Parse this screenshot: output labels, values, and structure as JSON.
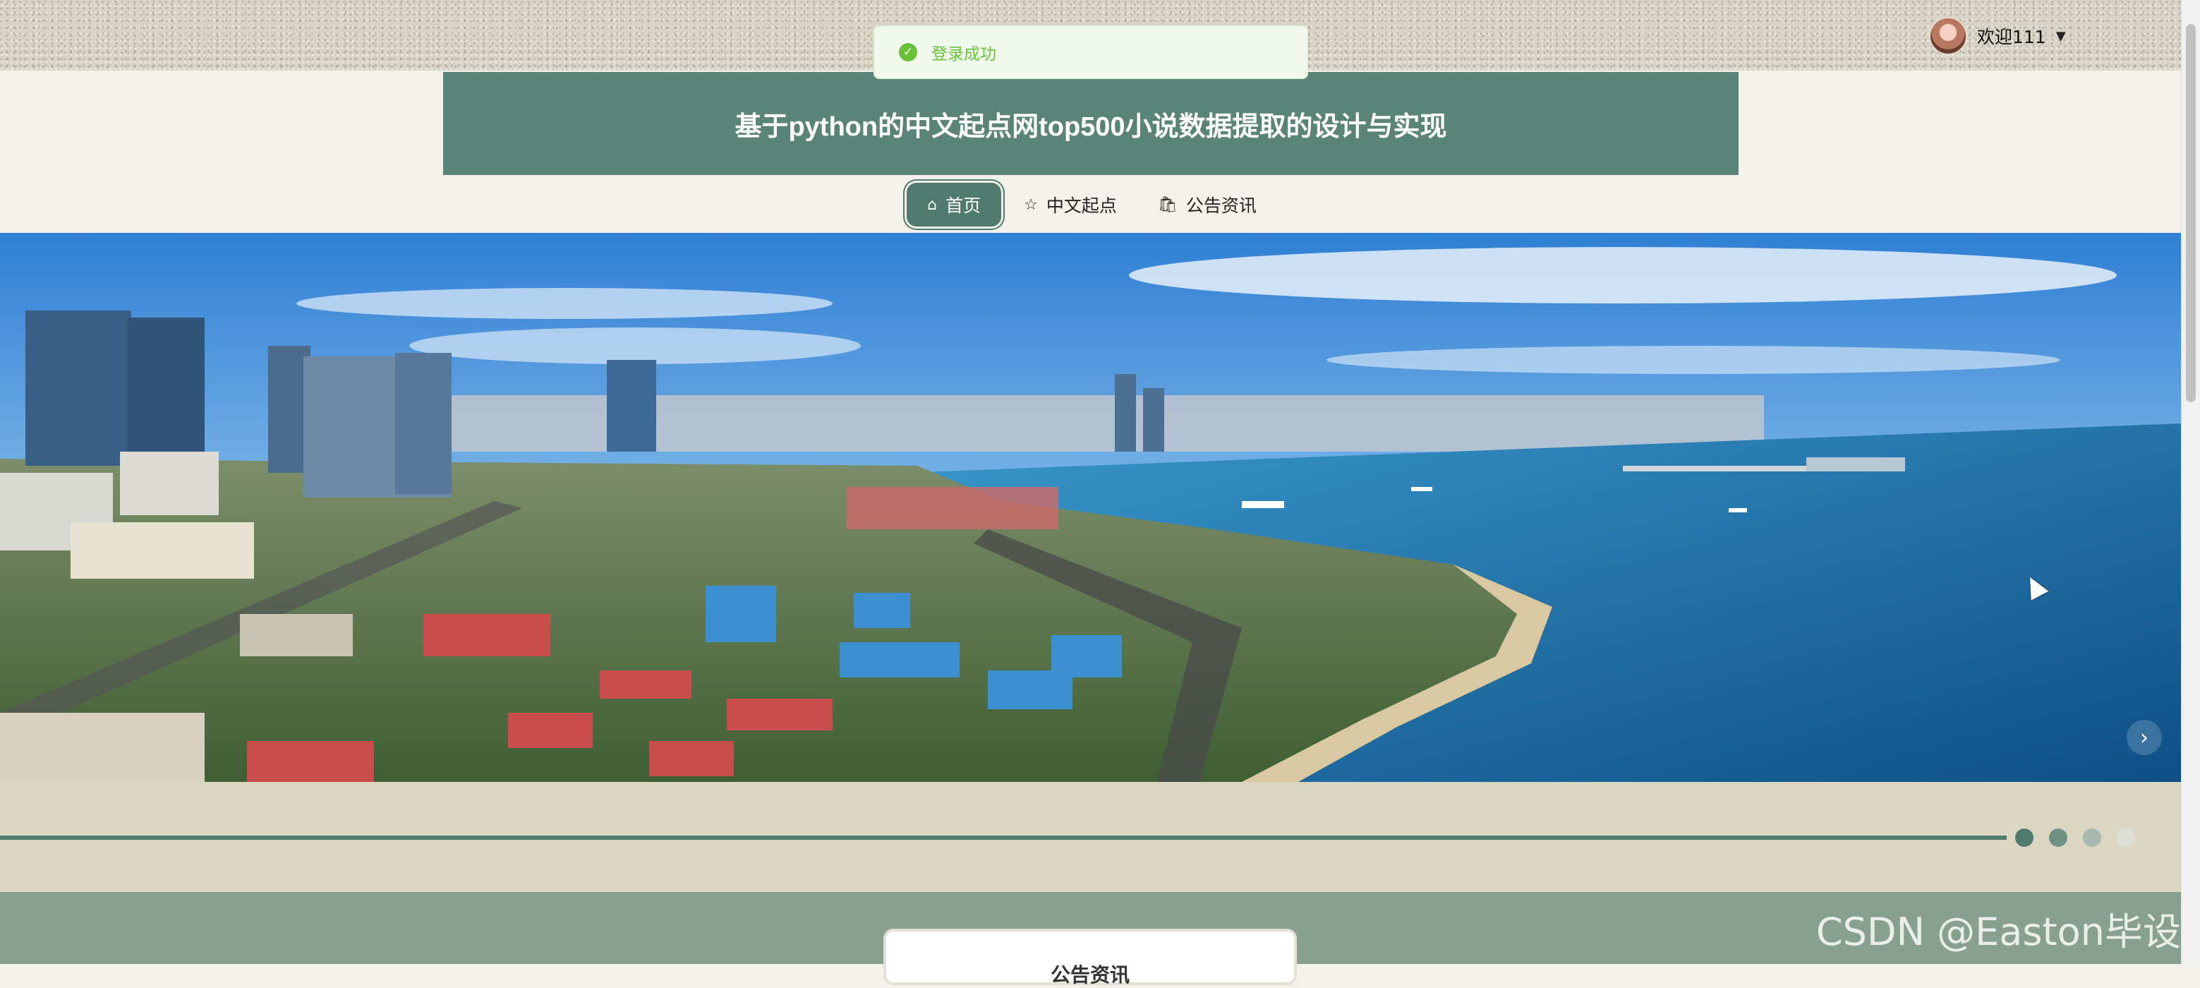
{
  "header": {
    "username": "欢迎111",
    "caret": "▼",
    "toast": "登录成功",
    "site_title": "基于python的中文起点网top500小说数据提取的设计与实现"
  },
  "nav": [
    {
      "label": "首页",
      "icon": "⌂"
    },
    {
      "label": "中文起点",
      "icon": "☆"
    },
    {
      "label": "公告资讯",
      "icon": "🛍"
    }
  ],
  "banner": {
    "next": "›",
    "slide_count": 3,
    "active_slide": 1
  },
  "section": {
    "title": "公告资讯",
    "dot_colors": [
      "#4f7a6d",
      "#6e9184",
      "#a8b9b0",
      "#dcdfd6"
    ]
  },
  "watermark": "CSDN @Easton毕设"
}
